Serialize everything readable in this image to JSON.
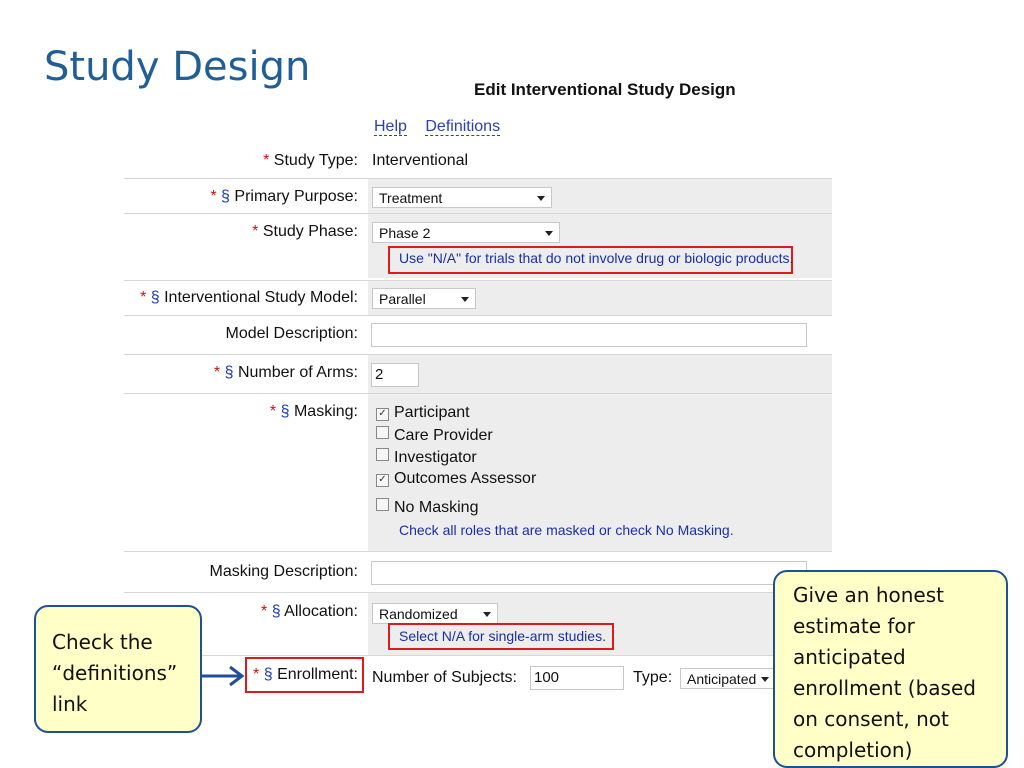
{
  "slide": {
    "title": "Study Design"
  },
  "form": {
    "title": "Edit Interventional Study Design",
    "links": {
      "help": "Help",
      "definitions": "Definitions"
    },
    "study_type": {
      "label": "Study Type:",
      "value": "Interventional"
    },
    "primary_purpose": {
      "label": "Primary Purpose:",
      "value": "Treatment"
    },
    "study_phase": {
      "label": "Study Phase:",
      "value": "Phase 2",
      "hint": "Use \"N/A\" for trials that do not involve drug or biologic products."
    },
    "model": {
      "label": "Interventional Study Model:",
      "value": "Parallel"
    },
    "model_description": {
      "label": "Model Description:",
      "value": ""
    },
    "arms": {
      "label": "Number of Arms:",
      "value": "2"
    },
    "masking": {
      "label": "Masking:",
      "options": [
        {
          "label": "Participant",
          "checked": true
        },
        {
          "label": "Care Provider",
          "checked": false
        },
        {
          "label": "Investigator",
          "checked": false
        },
        {
          "label": "Outcomes Assessor",
          "checked": true
        }
      ],
      "no_masking": {
        "label": "No Masking",
        "checked": false
      },
      "hint": "Check all roles that are masked or check No Masking."
    },
    "masking_description": {
      "label": "Masking Description:",
      "value": ""
    },
    "allocation": {
      "label": "Allocation:",
      "value": "Randomized",
      "hint": "Select N/A for single-arm studies."
    },
    "enrollment": {
      "label": "Enrollment:",
      "subjects_label": "Number of Subjects:",
      "subjects_value": "100",
      "type_label": "Type:",
      "type_value": "Anticipated"
    }
  },
  "markers": {
    "required": "*",
    "section": "§"
  },
  "callouts": {
    "left": "Check the “definitions” link",
    "right": "Give an honest estimate for anticipated enrollment (based on consent, not completion)"
  },
  "colors": {
    "title": "#1f5f96",
    "highlight": "#e01a1a",
    "callout_fill": "#ffffc8",
    "callout_border": "#1f4f9a"
  }
}
